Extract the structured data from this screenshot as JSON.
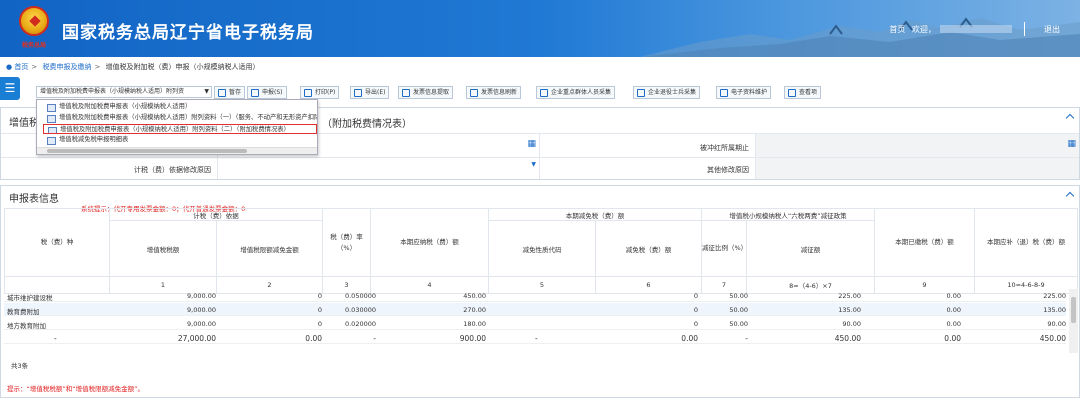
{
  "header": {
    "logo_text": "税务总局",
    "title": "国家税务总局辽宁省电子税务局",
    "home": "首页",
    "welcome": "欢迎，",
    "logout": "退出"
  },
  "breadcrumb": {
    "home": "首页",
    "level1": "税费申报及缴纳",
    "level2": "增值税及附加税（费）申报（小规模纳税人适用）"
  },
  "toolbar": {
    "select_value": "增值税及附加税费申报表（小规模纳税人适用）附列资",
    "buttons": [
      "暂存",
      "申报(S)",
      "打印(P)",
      "导出(E)",
      "发票信息提取",
      "发票信息刷新",
      "企业重点群体人员采集",
      "企业退役士兵采集",
      "电子资料维护",
      "查看项"
    ]
  },
  "dropdown": {
    "items": [
      "增值税及附加税费申报表（小规模纳税人适用）",
      "增值税及附加税费申报表（小规模纳税人适用）附列资料（一）（服务、不动产和无形资产扣除项目明细）",
      "增值税及附加税费申报表（小规模纳税人适用）附列资料（二）（附加税费情况表）",
      "增值税减免税申报明细表"
    ]
  },
  "panel1": {
    "title_left": "增值税",
    "title_right": "（附加税费情况表）",
    "field1": "被冲红所属期止",
    "field2": "计税（费）依据修改原因",
    "field3": "其他修改原因"
  },
  "declare": {
    "title": "申报表信息",
    "hint": "系统提示：代开专用发票金额：0；代开普通发票金额：0",
    "headers": {
      "tax_type": "税（费）种",
      "basis": "计税（费）依据",
      "vat_amount": "增值税税额",
      "vat_credit": "增值税限额减免金额",
      "rate": "税（费）率（%）",
      "payable": "本期应纳税（费）额",
      "reduce": "本期减免税（费）额",
      "reduce_code": "减免性质代码",
      "reduce_amount": "减免税（费）额",
      "policy": "增值税小规模纳税人“六税两费”减征政策",
      "policy_ratio": "减征比例（%）",
      "policy_amount": "减征额",
      "paid": "本期已缴税（费）额",
      "refund": "本期应补（退）税（费）额"
    },
    "index": [
      "1",
      "2",
      "3",
      "4",
      "5",
      "6",
      "7",
      "8=（4-6）×7",
      "9",
      "10=4-6-8-9"
    ],
    "rows": [
      {
        "name": "城市维护建设税",
        "c1": "9,000.00",
        "c2": "0",
        "c3": "0.050000",
        "c4": "450.00",
        "c5": "",
        "c6": "0",
        "c7": "50.00",
        "c8": "225.00",
        "c9": "0.00",
        "c10": "225.00"
      },
      {
        "name": "教育费附加",
        "c1": "9,000.00",
        "c2": "0",
        "c3": "0.030000",
        "c4": "270.00",
        "c5": "",
        "c6": "0",
        "c7": "50.00",
        "c8": "135.00",
        "c9": "0.00",
        "c10": "135.00"
      },
      {
        "name": "地方教育附加",
        "c1": "9,000.00",
        "c2": "0",
        "c3": "0.020000",
        "c4": "180.00",
        "c5": "",
        "c6": "0",
        "c7": "50.00",
        "c8": "90.00",
        "c9": "0.00",
        "c10": "90.00"
      },
      {
        "name": "-",
        "c1": "27,000.00",
        "c2": "0.00",
        "c3": "-",
        "c4": "900.00",
        "c5": "-",
        "c6": "0.00",
        "c7": "-",
        "c8": "450.00",
        "c9": "0.00",
        "c10": "450.00"
      }
    ],
    "count": "共3条",
    "note": "提示：“增值税税额”和“增值税限额减免金额”。"
  }
}
